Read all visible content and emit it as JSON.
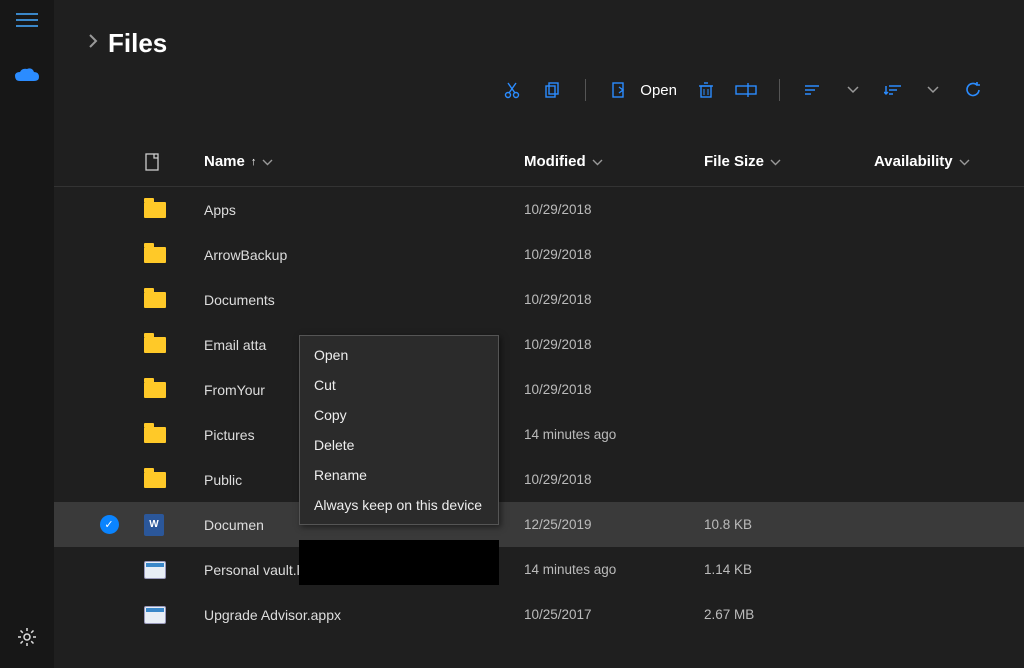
{
  "window": {
    "minimize": "–",
    "maximize": "□",
    "close": "✕"
  },
  "breadcrumb": {
    "title": "Files"
  },
  "toolbar": {
    "open_label": "Open"
  },
  "columns": {
    "name": "Name",
    "modified": "Modified",
    "filesize": "File Size",
    "availability": "Availability"
  },
  "rows": [
    {
      "kind": "folder",
      "name": "Apps",
      "modified": "10/29/2018",
      "size": "",
      "selected": false
    },
    {
      "kind": "folder",
      "name": "ArrowBackup",
      "modified": "10/29/2018",
      "size": "",
      "selected": false
    },
    {
      "kind": "folder",
      "name": "Documents",
      "modified": "10/29/2018",
      "size": "",
      "selected": false
    },
    {
      "kind": "folder",
      "name": "Email atta",
      "modified": "10/29/2018",
      "size": "",
      "selected": false
    },
    {
      "kind": "folder",
      "name": "FromYour",
      "modified": "10/29/2018",
      "size": "",
      "selected": false
    },
    {
      "kind": "folder",
      "name": "Pictures",
      "modified": "14 minutes ago",
      "size": "",
      "selected": false
    },
    {
      "kind": "folder",
      "name": "Public",
      "modified": "10/29/2018",
      "size": "",
      "selected": false
    },
    {
      "kind": "doc",
      "name": "Documen",
      "modified": "12/25/2019",
      "size": "10.8 KB",
      "selected": true
    },
    {
      "kind": "lnk",
      "name": "Personal vault.lnk",
      "modified": "14 minutes ago",
      "size": "1.14 KB",
      "selected": false
    },
    {
      "kind": "appx",
      "name": "Upgrade Advisor.appx",
      "modified": "10/25/2017",
      "size": "2.67 MB",
      "selected": false
    }
  ],
  "context_menu": {
    "items": [
      "Open",
      "Cut",
      "Copy",
      "Delete",
      "Rename",
      "Always keep on this device"
    ]
  }
}
